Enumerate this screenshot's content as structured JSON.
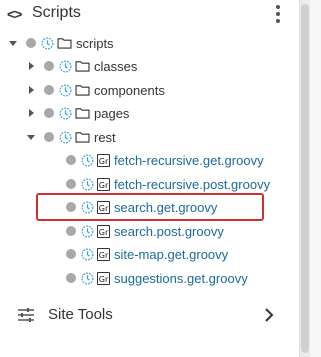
{
  "header": {
    "title": "Scripts",
    "code_icon": "<>"
  },
  "tree": {
    "root": {
      "label": "scripts",
      "expanded": true
    },
    "folders": [
      {
        "label": "classes",
        "expanded": false
      },
      {
        "label": "components",
        "expanded": false
      },
      {
        "label": "pages",
        "expanded": false
      },
      {
        "label": "rest",
        "expanded": true
      }
    ],
    "files": [
      {
        "label": "fetch-recursive.get.groovy",
        "badge": "Gr"
      },
      {
        "label": "fetch-recursive.post.groovy",
        "badge": "Gr"
      },
      {
        "label": "search.get.groovy",
        "badge": "Gr",
        "highlighted": true
      },
      {
        "label": "search.post.groovy",
        "badge": "Gr"
      },
      {
        "label": "site-map.get.groovy",
        "badge": "Gr"
      },
      {
        "label": "suggestions.get.groovy",
        "badge": "Gr"
      }
    ]
  },
  "site_tools": {
    "label": "Site Tools"
  },
  "colors": {
    "file_link": "#1a6b9a",
    "highlight_border": "#d0312d",
    "status_dot": "#a8a8a8",
    "clock_icon": "#3ba3d8"
  }
}
